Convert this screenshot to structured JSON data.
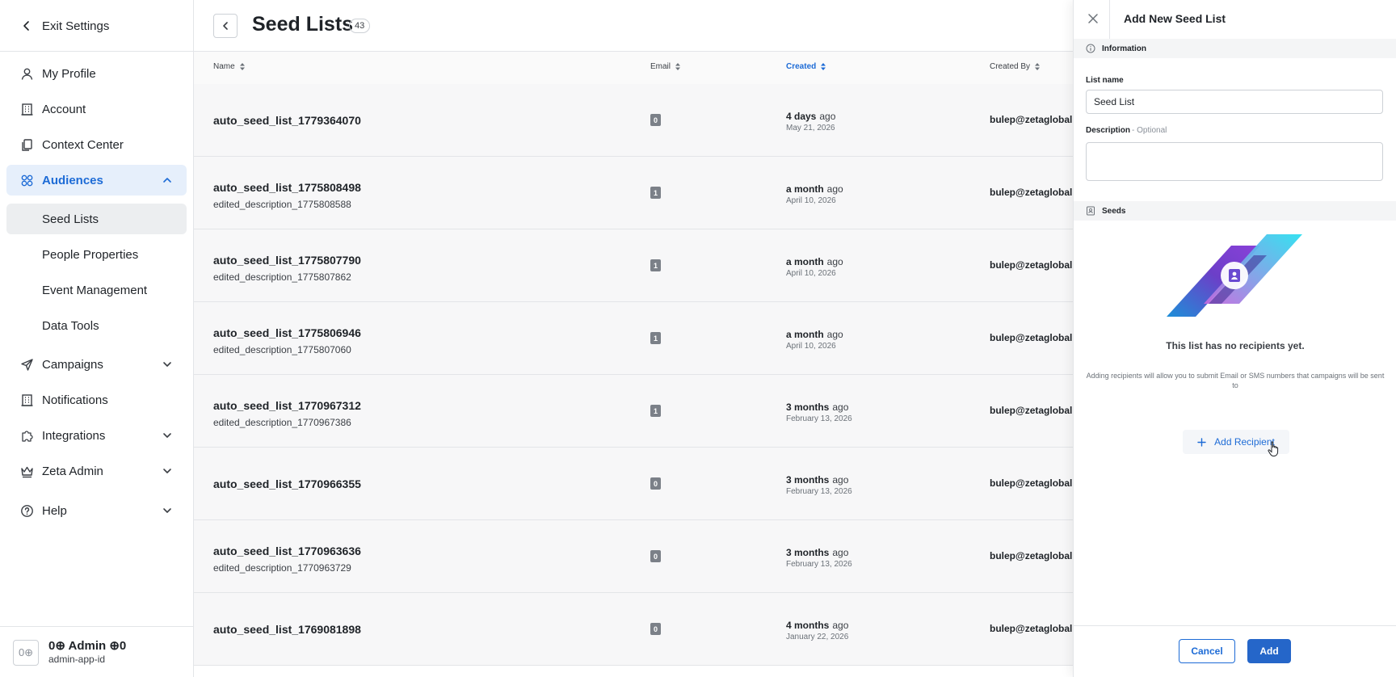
{
  "sidebar": {
    "exit_label": "Exit Settings",
    "items": [
      {
        "label": "My Profile"
      },
      {
        "label": "Account"
      },
      {
        "label": "Context Center"
      },
      {
        "label": "Audiences"
      },
      {
        "label": "Campaigns"
      },
      {
        "label": "Notifications"
      },
      {
        "label": "Integrations"
      },
      {
        "label": "Zeta Admin"
      },
      {
        "label": "Help"
      }
    ],
    "sub_items": [
      {
        "label": "Seed Lists"
      },
      {
        "label": "People Properties"
      },
      {
        "label": "Event Management"
      },
      {
        "label": "Data Tools"
      }
    ],
    "user": {
      "avatar": "0⊕",
      "name": "0⊕ Admin ⊕0",
      "app_id": "admin-app-id"
    }
  },
  "main": {
    "title": "Seed Lists",
    "count": "43",
    "columns": {
      "name": "Name",
      "email": "Email",
      "created": "Created",
      "created_by": "Created By"
    },
    "rows": [
      {
        "name": "auto_seed_list_1779364070",
        "description": "",
        "email": "0",
        "relative": "4 days",
        "ago": "ago",
        "date": "May 21, 2026",
        "created_by": "bulep@zetaglobal.c"
      },
      {
        "name": "auto_seed_list_1775808498",
        "description": "edited_description_1775808588",
        "email": "1",
        "relative": "a month",
        "ago": "ago",
        "date": "April 10, 2026",
        "created_by": "bulep@zetaglobal.c"
      },
      {
        "name": "auto_seed_list_1775807790",
        "description": "edited_description_1775807862",
        "email": "1",
        "relative": "a month",
        "ago": "ago",
        "date": "April 10, 2026",
        "created_by": "bulep@zetaglobal.c"
      },
      {
        "name": "auto_seed_list_1775806946",
        "description": "edited_description_1775807060",
        "email": "1",
        "relative": "a month",
        "ago": "ago",
        "date": "April 10, 2026",
        "created_by": "bulep@zetaglobal.c"
      },
      {
        "name": "auto_seed_list_1770967312",
        "description": "edited_description_1770967386",
        "email": "1",
        "relative": "3 months",
        "ago": "ago",
        "date": "February 13, 2026",
        "created_by": "bulep@zetaglobal.c"
      },
      {
        "name": "auto_seed_list_1770966355",
        "description": "",
        "email": "0",
        "relative": "3 months",
        "ago": "ago",
        "date": "February 13, 2026",
        "created_by": "bulep@zetaglobal.c"
      },
      {
        "name": "auto_seed_list_1770963636",
        "description": "edited_description_1770963729",
        "email": "0",
        "relative": "3 months",
        "ago": "ago",
        "date": "February 13, 2026",
        "created_by": "bulep@zetaglobal.c"
      },
      {
        "name": "auto_seed_list_1769081898",
        "description": "",
        "email": "0",
        "relative": "4 months",
        "ago": "ago",
        "date": "January 22, 2026",
        "created_by": "bulep@zetaglobal.c"
      }
    ]
  },
  "panel": {
    "title": "Add New Seed List",
    "information_label": "Information",
    "list_name_label": "List name",
    "list_name_value": "Seed List",
    "description_label": "Description",
    "description_optional": "- Optional",
    "description_value": "",
    "seeds_label": "Seeds",
    "empty_title": "This list has no recipients yet.",
    "empty_sub": "Adding recipients will allow you to submit Email or SMS numbers that campaigns will be sent to",
    "add_recipient_label": "Add Recipient",
    "cancel_label": "Cancel",
    "add_label": "Add"
  },
  "colors": {
    "accent": "#1d6bd6",
    "primary_button": "#2566c9",
    "active_nav_bg": "#e6effb",
    "row_bg": "#f7f7f8"
  },
  "icons": {
    "exit": "chevron-left-icon",
    "my_profile": "user-icon",
    "account": "building-icon",
    "context_center": "documents-icon",
    "audiences": "audience-circles-icon",
    "campaigns": "paper-plane-icon",
    "notifications": "building-icon",
    "integrations": "puzzle-icon",
    "zeta_admin": "crown-icon",
    "help": "help-circle-icon",
    "information": "info-icon",
    "seeds": "contact-book-icon"
  }
}
